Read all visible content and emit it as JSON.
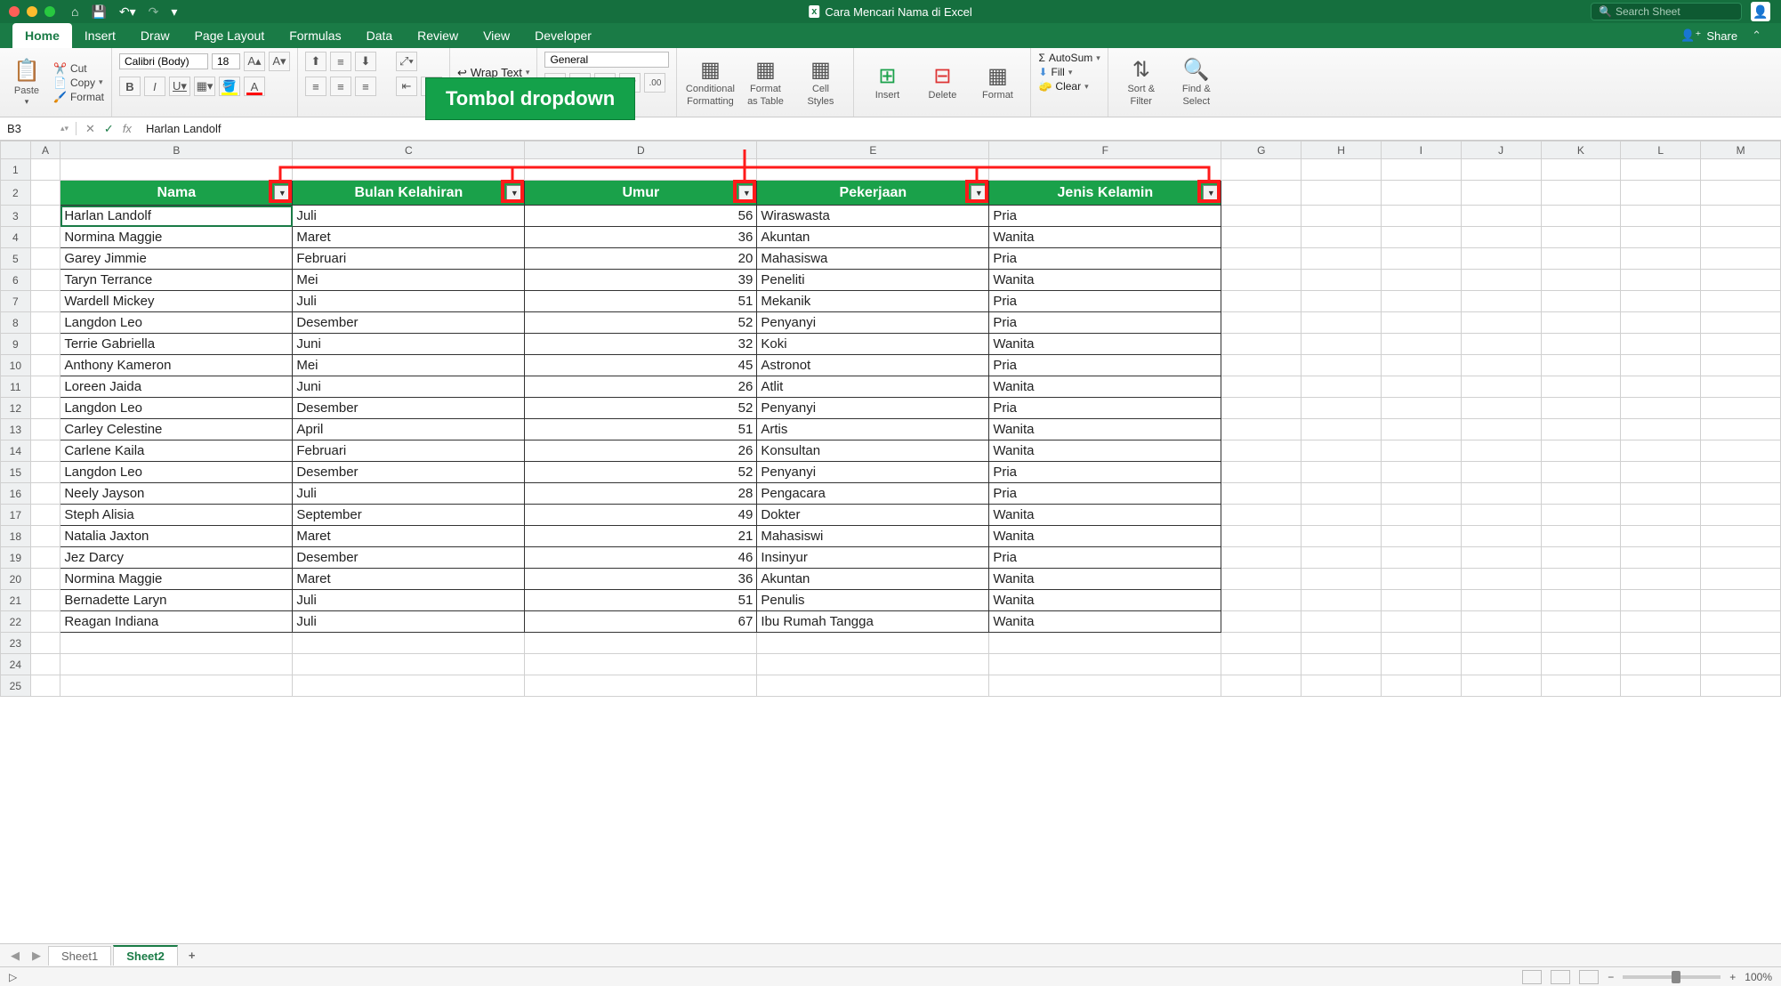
{
  "titlebar": {
    "title": "Cara Mencari Nama di Excel",
    "search_placeholder": "Search Sheet"
  },
  "ribbon_tabs": [
    "Home",
    "Insert",
    "Draw",
    "Page Layout",
    "Formulas",
    "Data",
    "Review",
    "View",
    "Developer"
  ],
  "share_label": "Share",
  "clipboard": {
    "paste": "Paste",
    "cut": "Cut",
    "copy": "Copy",
    "format": "Format"
  },
  "font": {
    "name": "Calibri (Body)",
    "size": "18",
    "bold": "B",
    "italic": "I",
    "underline": "U"
  },
  "alignment": {
    "wrap": "Wrap Text"
  },
  "number": {
    "format": "General",
    "percent": "%"
  },
  "styles": {
    "cond": "Conditional\nFormatting",
    "format_table": "Format\nas Table",
    "cell_styles": "Cell\nStyles"
  },
  "cells": {
    "insert": "Insert",
    "delete": "Delete",
    "format": "Format"
  },
  "editing": {
    "autosum": "AutoSum",
    "fill": "Fill",
    "clear": "Clear",
    "sort": "Sort &\nFilter",
    "find": "Find &\nSelect"
  },
  "callout": "Tombol dropdown",
  "formula_bar": {
    "cell_ref": "B3",
    "fx": "fx",
    "value": "Harlan Landolf"
  },
  "columns": [
    "A",
    "B",
    "C",
    "D",
    "E",
    "F",
    "G",
    "H",
    "I",
    "J",
    "K",
    "L",
    "M"
  ],
  "row_numbers": [
    1,
    2,
    3,
    4,
    5,
    6,
    7,
    8,
    9,
    10,
    11,
    12,
    13,
    14,
    15,
    16,
    17,
    18,
    19,
    20,
    21,
    22,
    23,
    24,
    25
  ],
  "headers": [
    "Nama",
    "Bulan Kelahiran",
    "Umur",
    "Pekerjaan",
    "Jenis Kelamin"
  ],
  "data": [
    [
      "Harlan Landolf",
      "Juli",
      "56",
      "Wiraswasta",
      "Pria"
    ],
    [
      "Normina Maggie",
      "Maret",
      "36",
      "Akuntan",
      "Wanita"
    ],
    [
      "Garey Jimmie",
      "Februari",
      "20",
      "Mahasiswa",
      "Pria"
    ],
    [
      "Taryn Terrance",
      "Mei",
      "39",
      "Peneliti",
      "Wanita"
    ],
    [
      "Wardell Mickey",
      "Juli",
      "51",
      "Mekanik",
      "Pria"
    ],
    [
      "Langdon Leo",
      "Desember",
      "52",
      "Penyanyi",
      "Pria"
    ],
    [
      "Terrie Gabriella",
      "Juni",
      "32",
      "Koki",
      "Wanita"
    ],
    [
      "Anthony Kameron",
      "Mei",
      "45",
      "Astronot",
      "Pria"
    ],
    [
      "Loreen Jaida",
      "Juni",
      "26",
      "Atlit",
      "Wanita"
    ],
    [
      "Langdon Leo",
      "Desember",
      "52",
      "Penyanyi",
      "Pria"
    ],
    [
      "Carley Celestine",
      "April",
      "51",
      "Artis",
      "Wanita"
    ],
    [
      "Carlene Kaila",
      "Februari",
      "26",
      "Konsultan",
      "Wanita"
    ],
    [
      "Langdon Leo",
      "Desember",
      "52",
      "Penyanyi",
      "Pria"
    ],
    [
      "Neely Jayson",
      "Juli",
      "28",
      "Pengacara",
      "Pria"
    ],
    [
      "Steph Alisia",
      "September",
      "49",
      "Dokter",
      "Wanita"
    ],
    [
      "Natalia Jaxton",
      "Maret",
      "21",
      "Mahasiswi",
      "Wanita"
    ],
    [
      "Jez Darcy",
      "Desember",
      "46",
      "Insinyur",
      "Pria"
    ],
    [
      "Normina Maggie",
      "Maret",
      "36",
      "Akuntan",
      "Wanita"
    ],
    [
      "Bernadette Laryn",
      "Juli",
      "51",
      "Penulis",
      "Wanita"
    ],
    [
      "Reagan Indiana",
      "Juli",
      "67",
      "Ibu Rumah Tangga",
      "Wanita"
    ]
  ],
  "sheet_tabs": [
    "Sheet1",
    "Sheet2"
  ],
  "active_sheet": "Sheet2",
  "zoom": "100%"
}
